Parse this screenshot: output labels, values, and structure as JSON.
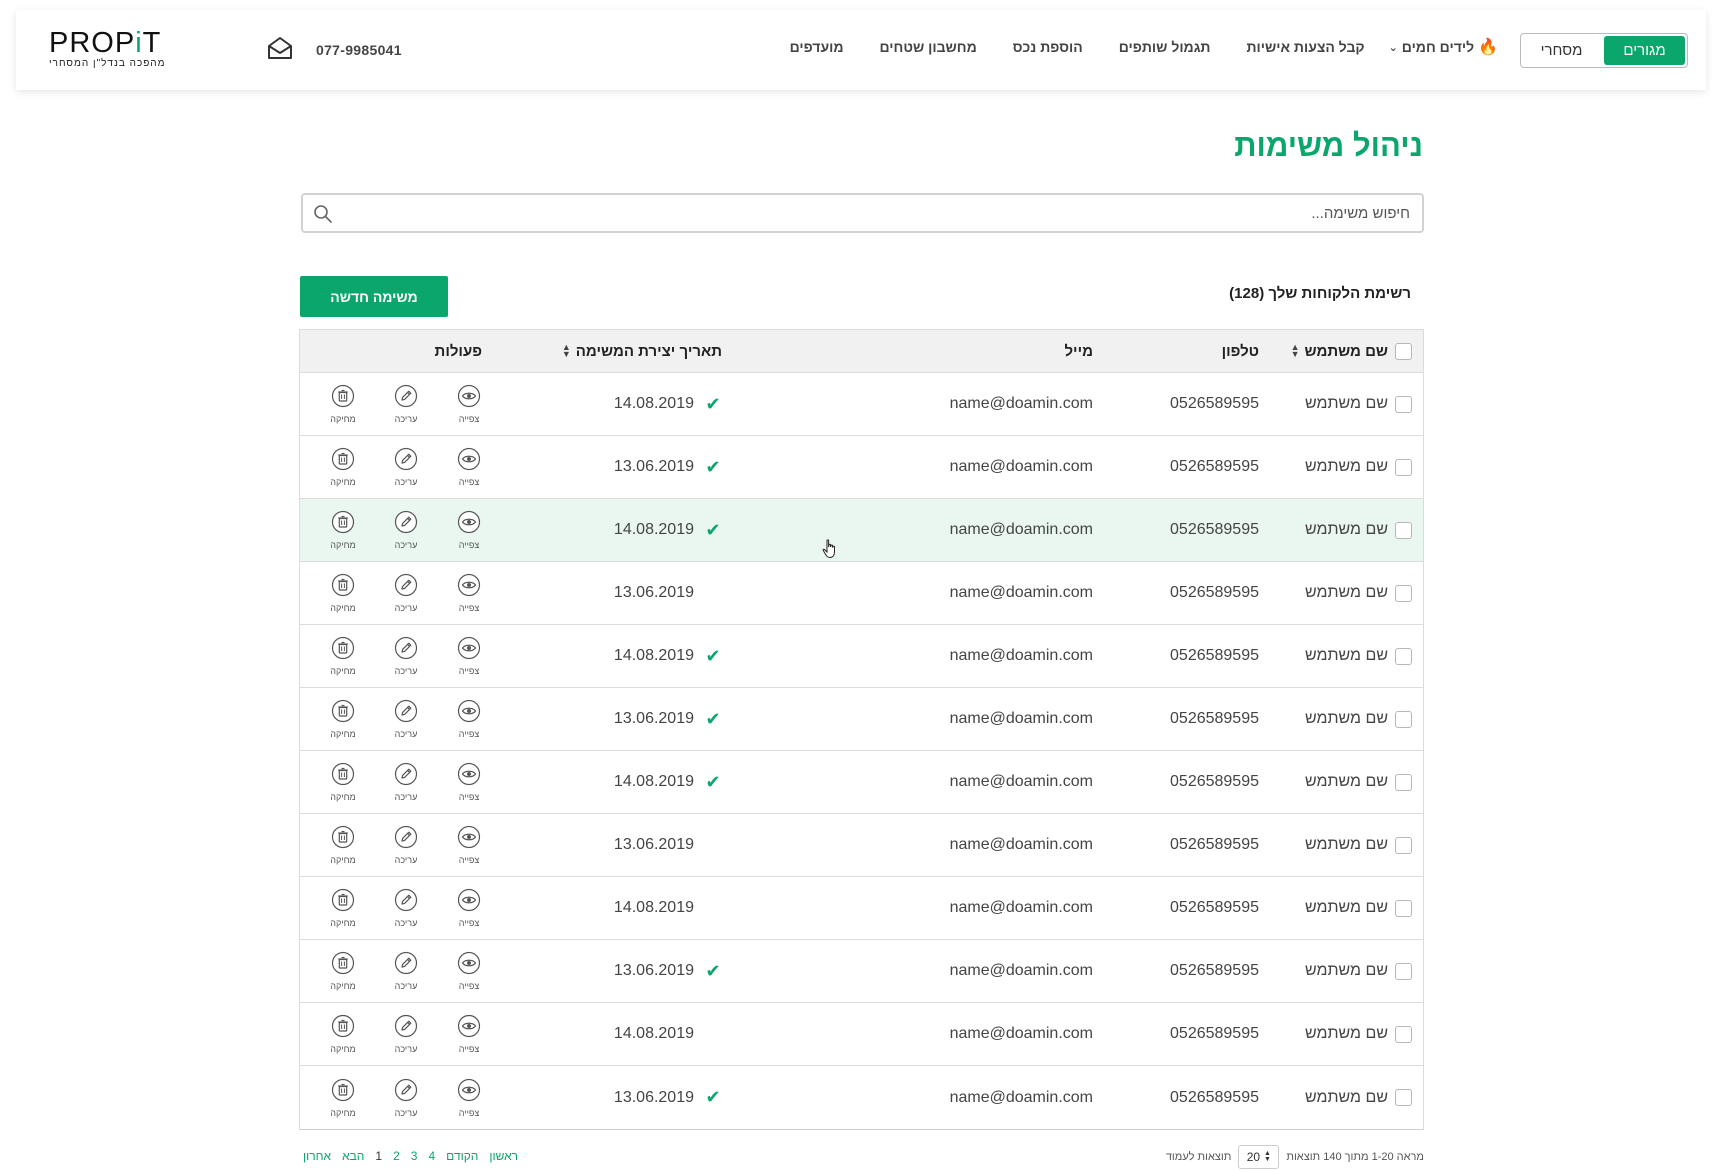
{
  "header": {
    "logo_text": "PROPiT",
    "logo_tagline": "מהפכה בנדל\"ן המסחרי",
    "phone": "077-9985041",
    "nav": [
      {
        "label": "מועדפים"
      },
      {
        "label": "מחשבון שטחים"
      },
      {
        "label": "הוספת נכס"
      },
      {
        "label": "תגמול שותפים"
      },
      {
        "label": "קבל הצעות אישיות"
      },
      {
        "label": "לידים חמים"
      }
    ],
    "role_toggle": {
      "active": "מגורים",
      "inactive": "מסחרי"
    }
  },
  "page_title": "ניהול משימות",
  "search": {
    "placeholder": "חיפוש משימה..."
  },
  "list_caption": "רשימת הלקוחות שלך (128)",
  "new_button": "משימה חדשה",
  "table": {
    "columns": {
      "name": "שם משתמש",
      "phone": "טלפון",
      "mail": "מייל",
      "date": "תאריך יצירת המשימה",
      "actions": "פעולות"
    },
    "action_labels": {
      "view": "צפייה",
      "edit": "עריכה",
      "delete": "מחיקה"
    },
    "rows": [
      {
        "name": "שם משתמש",
        "phone": "0526589595",
        "mail": "name@doamin.com",
        "date": "14.08.2019",
        "checked": true
      },
      {
        "name": "שם משתמש",
        "phone": "0526589595",
        "mail": "name@doamin.com",
        "date": "13.06.2019",
        "checked": true
      },
      {
        "name": "שם משתמש",
        "phone": "0526589595",
        "mail": "name@doamin.com",
        "date": "14.08.2019",
        "checked": true,
        "highlight": true
      },
      {
        "name": "שם משתמש",
        "phone": "0526589595",
        "mail": "name@doamin.com",
        "date": "13.06.2019",
        "checked": false
      },
      {
        "name": "שם משתמש",
        "phone": "0526589595",
        "mail": "name@doamin.com",
        "date": "14.08.2019",
        "checked": true
      },
      {
        "name": "שם משתמש",
        "phone": "0526589595",
        "mail": "name@doamin.com",
        "date": "13.06.2019",
        "checked": true
      },
      {
        "name": "שם משתמש",
        "phone": "0526589595",
        "mail": "name@doamin.com",
        "date": "14.08.2019",
        "checked": true
      },
      {
        "name": "שם משתמש",
        "phone": "0526589595",
        "mail": "name@doamin.com",
        "date": "13.06.2019",
        "checked": false
      },
      {
        "name": "שם משתמש",
        "phone": "0526589595",
        "mail": "name@doamin.com",
        "date": "14.08.2019",
        "checked": false
      },
      {
        "name": "שם משתמש",
        "phone": "0526589595",
        "mail": "name@doamin.com",
        "date": "13.06.2019",
        "checked": true
      },
      {
        "name": "שם משתמש",
        "phone": "0526589595",
        "mail": "name@doamin.com",
        "date": "14.08.2019",
        "checked": false
      },
      {
        "name": "שם משתמש",
        "phone": "0526589595",
        "mail": "name@doamin.com",
        "date": "13.06.2019",
        "checked": true
      }
    ]
  },
  "footer": {
    "results_text": "מראה 1-20 מתוך 140 תוצאות",
    "per_page_value": "20",
    "per_page_label": "תוצאות לעמוד",
    "pager": {
      "last": "אחרון",
      "next": "הבא",
      "pages": [
        "1",
        "2",
        "3",
        "4"
      ],
      "prev": "הקודם",
      "first": "ראשון"
    }
  },
  "colors": {
    "accent": "#0aa66b",
    "row_highlight": "#eaf7f0",
    "fire": "#ff5a1f"
  }
}
